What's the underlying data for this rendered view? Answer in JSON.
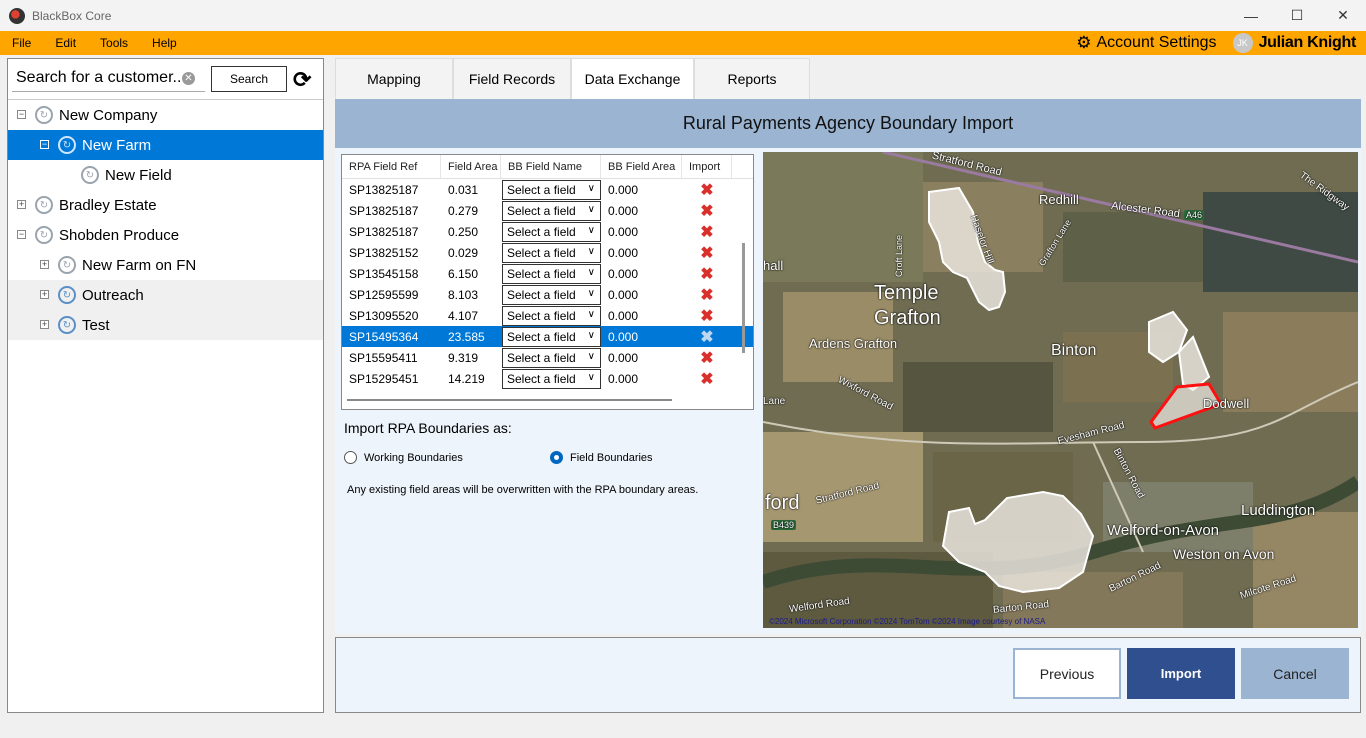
{
  "window": {
    "title": "BlackBox Core",
    "minimize": "—",
    "maximize": "☐",
    "close": "✕"
  },
  "menu": [
    "File",
    "Edit",
    "Tools",
    "Help"
  ],
  "account": {
    "settings_label": "Account Settings",
    "initials": "JK",
    "user_name": "Julian Knight"
  },
  "search": {
    "value": "Search for a customer..",
    "button_label": "Search"
  },
  "tree": [
    {
      "label": "New Company",
      "expander": "⊟",
      "level": "root"
    },
    {
      "label": "New Farm",
      "expander": "⊟",
      "level": "farm",
      "selected": true
    },
    {
      "label": "New Field",
      "level": "field"
    },
    {
      "label": "Bradley Estate",
      "expander": "⊞",
      "level": "root"
    },
    {
      "label": "Shobden Produce",
      "expander": "⊟",
      "level": "root"
    },
    {
      "label": "New Farm on FN",
      "expander": "⊞",
      "level": "farm"
    },
    {
      "label": "Outreach",
      "expander": "⊞",
      "level": "farm"
    },
    {
      "label": "Test",
      "expander": "⊞",
      "level": "farm"
    }
  ],
  "tabs": [
    "Mapping",
    "Field Records",
    "Data Exchange",
    "Reports"
  ],
  "active_tab": "Data Exchange",
  "banner_title": "Rural Payments Agency Boundary Import",
  "grid": {
    "columns": [
      "RPA Field Ref",
      "Field Area",
      "BB Field Name",
      "BB Field Area",
      "Import"
    ],
    "select_placeholder": "Select a field",
    "rows": [
      {
        "ref": "SP13825187",
        "area": "0.031",
        "bb_area": "0.000"
      },
      {
        "ref": "SP13825187",
        "area": "0.279",
        "bb_area": "0.000"
      },
      {
        "ref": "SP13825187",
        "area": "0.250",
        "bb_area": "0.000"
      },
      {
        "ref": "SP13825152",
        "area": "0.029",
        "bb_area": "0.000"
      },
      {
        "ref": "SP13545158",
        "area": "6.150",
        "bb_area": "0.000"
      },
      {
        "ref": "SP12595599",
        "area": "8.103",
        "bb_area": "0.000"
      },
      {
        "ref": "SP13095520",
        "area": "4.107",
        "bb_area": "0.000"
      },
      {
        "ref": "SP15495364",
        "area": "23.585",
        "bb_area": "0.000",
        "selected": true
      },
      {
        "ref": "SP15595411",
        "area": "9.319",
        "bb_area": "0.000"
      },
      {
        "ref": "SP15295451",
        "area": "14.219",
        "bb_area": "0.000"
      }
    ]
  },
  "import_options": {
    "label": "Import RPA Boundaries as:",
    "working": "Working Boundaries",
    "field": "Field Boundaries",
    "selected": "Field Boundaries",
    "note": "Any existing field areas will be overwritten with the RPA boundary areas."
  },
  "map": {
    "labels": {
      "stratford_road": "Stratford Road",
      "redhill": "Redhill",
      "alcester_road": "Alcester Road",
      "a46": "A46",
      "the_ridgway": "The Ridgway",
      "haselor_hill": "Haselor Hill",
      "croft_lane": "Croft Lane",
      "grafton_lane": "Grafton Lane",
      "hall": "hall",
      "temple": "Temple",
      "grafton": "Grafton",
      "ardens_grafton": "Ardens Grafton",
      "binton": "Binton",
      "dodwell": "Dodwell",
      "wixford_road": "Wixford Road",
      "lane": "Lane",
      "evesham_road": "Evesham Road",
      "binton_road": "Binton Road",
      "ford": "ford",
      "stratford_road_2": "Stratford Road",
      "b439": "B439",
      "luddington": "Luddington",
      "welford_on_avon": "Welford-on-Avon",
      "weston_on_avon": "Weston on Avon",
      "barton_road": "Barton Road",
      "milcote_road": "Milcote Road",
      "welford_road": "Welford Road",
      "barton_road_2": "Barton Road"
    },
    "copyright": "©2024 Microsoft Corporation ©2024 TomTom ©2024 Image courtesy of NASA"
  },
  "buttons": {
    "previous": "Previous",
    "import": "Import",
    "cancel": "Cancel"
  }
}
